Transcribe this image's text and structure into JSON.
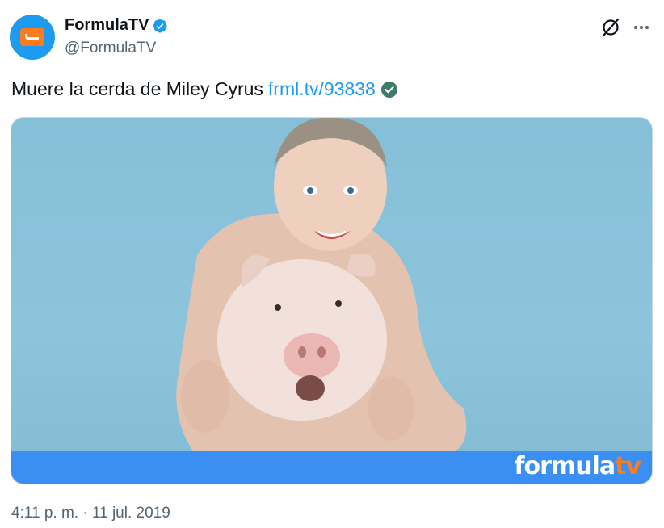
{
  "author": {
    "display_name": "FormulaTV",
    "handle": "@FormulaTV",
    "avatar_icon": "formulatv-logo-icon",
    "verified_icon": "verified-badge-icon"
  },
  "tweet": {
    "text": "Muere la cerda de Miley Cyrus",
    "link": "frml.tv/93838",
    "link_badge_icon": "check-circle-icon"
  },
  "media": {
    "watermark": "formulatv",
    "watermark_main": "formula",
    "watermark_accent": "tv"
  },
  "timestamp": "4:11 p. m. · 11 jul. 2019",
  "actions": {
    "grok_icon": "grok-icon",
    "more_icon": "more-icon"
  },
  "colors": {
    "accent": "#1d9bf0",
    "brand_orange": "#ff7a1a",
    "brand_bar": "#3b8ff3",
    "muted_text": "#536471",
    "link_check": "#00ba7c"
  }
}
